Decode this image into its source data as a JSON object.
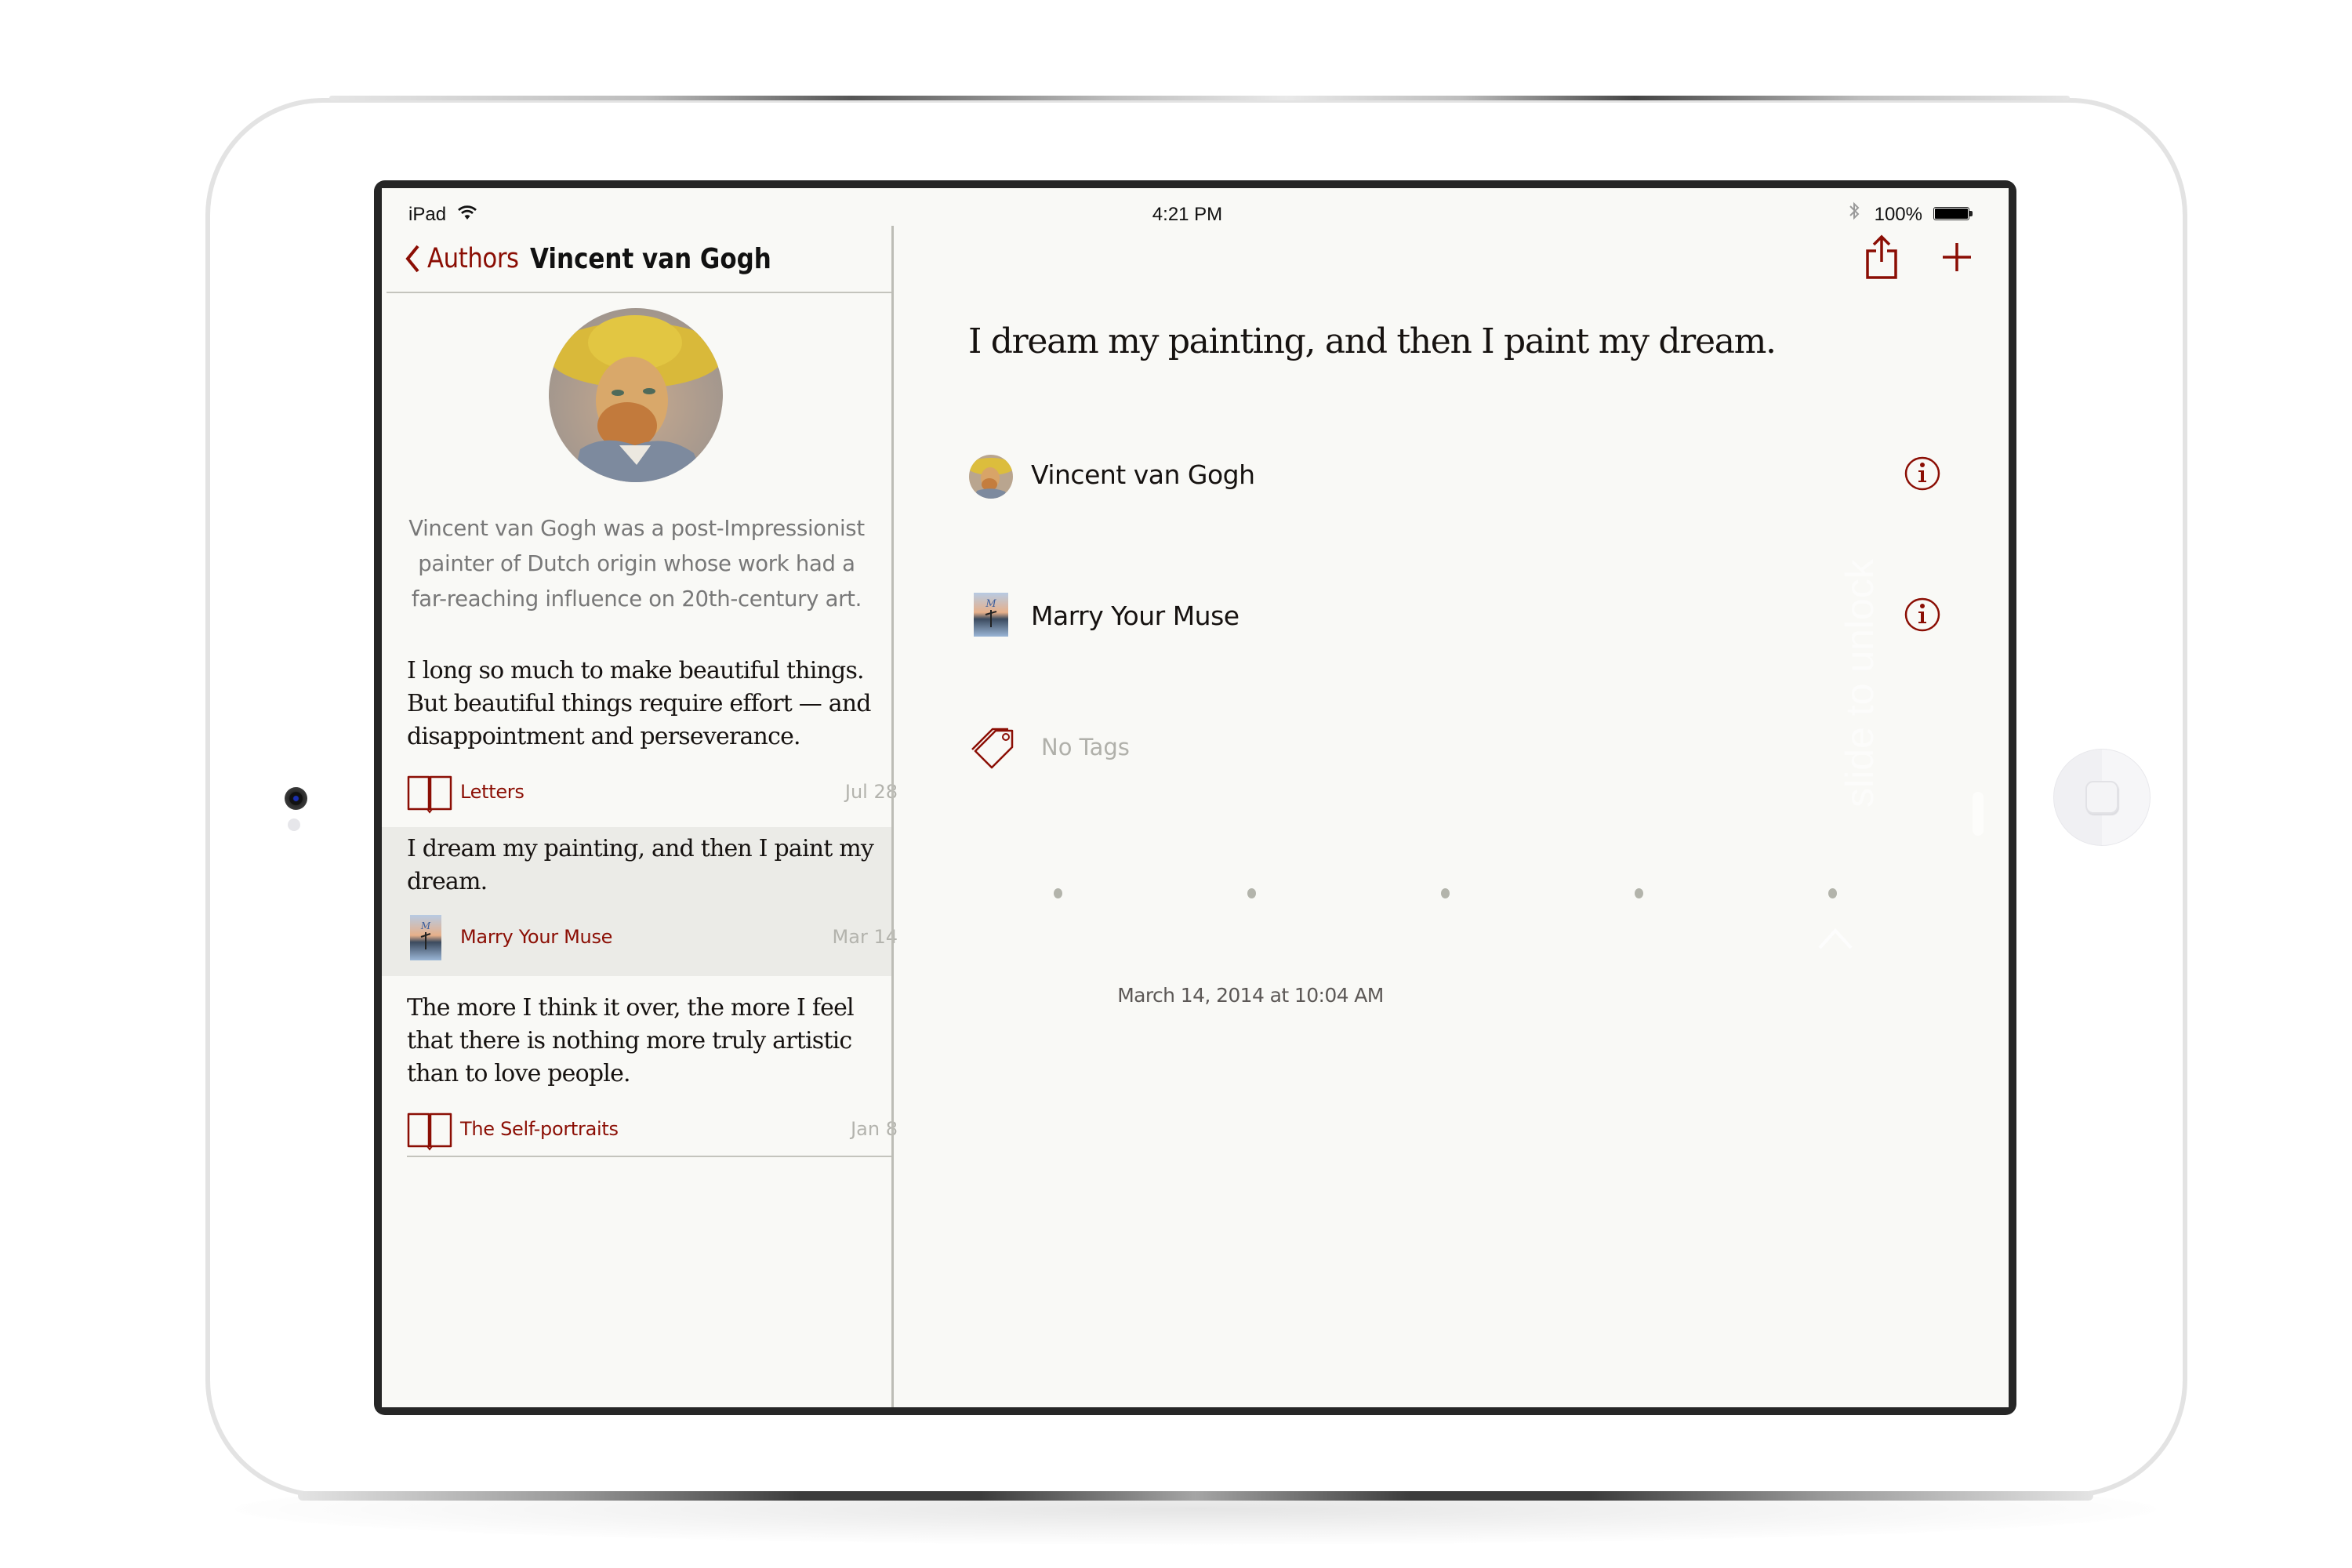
{
  "status_bar": {
    "carrier": "iPad",
    "time": "4:21 PM",
    "battery_percent": "100%",
    "battery_level": 1.0,
    "icons": [
      "wifi-icon",
      "bluetooth-icon",
      "battery-icon"
    ]
  },
  "sidebar": {
    "back_label": "Authors",
    "title": "Vincent van Gogh",
    "avatar": "van-gogh-self-portrait",
    "bio_lines": [
      "Vincent van Gogh was a post-Impressionist",
      "painter of Dutch origin whose work had a",
      "far-reaching influence on 20th-century art."
    ],
    "quotes": [
      {
        "lines": [
          "I long so much to make beautiful things.",
          "But beautiful things require effort — and",
          "disappointment and perseverance."
        ],
        "source": "Letters",
        "source_icon": "book-icon",
        "date": "Jul 28",
        "selected": false
      },
      {
        "lines": [
          "I dream my painting, and then I paint my",
          "dream."
        ],
        "source": "Marry Your Muse",
        "source_icon": "book-cover-thumbnail",
        "date": "Mar 14",
        "selected": true
      },
      {
        "lines": [
          "The more I think it over, the more I feel",
          "that there is nothing more truly artistic",
          "than to love people."
        ],
        "source": "The Self-portraits",
        "source_icon": "book-icon",
        "date": "Jan 8",
        "selected": false
      }
    ]
  },
  "detail": {
    "toolbar": {
      "share_icon": "share-icon",
      "add_icon": "plus-icon"
    },
    "quote": "I dream my painting, and then I paint my dream.",
    "author": "Vincent van Gogh",
    "source": "Marry Your Muse",
    "tags_label": "No Tags",
    "page_dots": 5,
    "timestamp": "March 14, 2014 at 10:04 AM"
  },
  "lock_overlay": {
    "text": "slide to unlock"
  },
  "colors": {
    "accent": "#8b0e04",
    "background": "#f9f9f6",
    "selected_row": "#ebebe7",
    "muted_text": "#787878",
    "date_text": "#b3b3ad"
  }
}
